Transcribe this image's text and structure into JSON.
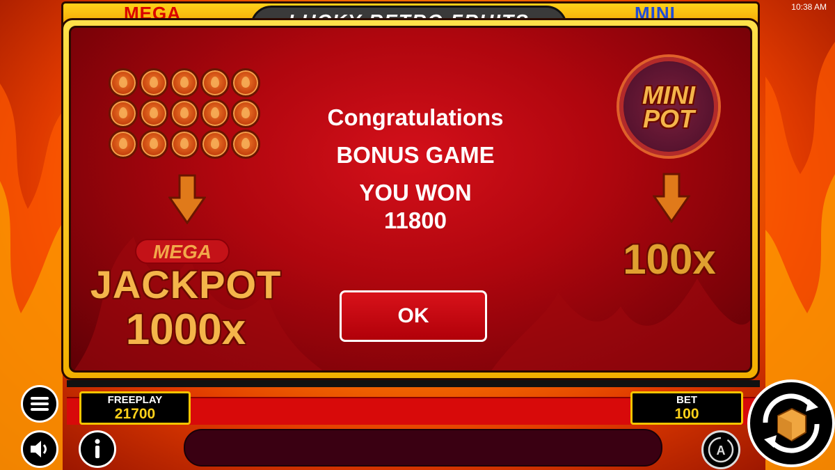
{
  "clock": "10:38 AM",
  "top_frame": {
    "mega_label": "MEGA",
    "mini_label": "MINI",
    "title": "LUCKY RETRO FRUITS"
  },
  "dialog": {
    "left_panel": {
      "mega_label": "MEGA",
      "jackpot_label": "JACKPOT",
      "multiplier": "1000x"
    },
    "right_panel": {
      "badge_label": "MINI POT",
      "multiplier": "100x"
    },
    "message": {
      "line1": "Congratulations",
      "line2": "BONUS GAME",
      "line3": "YOU WON",
      "amount": "11800"
    },
    "ok_label": "OK"
  },
  "hud": {
    "freeplay": {
      "label": "FREEPLAY",
      "value": "21700"
    },
    "bet": {
      "label": "BET",
      "value": "100"
    }
  },
  "icons": [
    "menu-icon",
    "sound-icon",
    "info-icon",
    "autoplay-icon",
    "spin-icon",
    "flame-icon",
    "down-arrow-icon"
  ],
  "colors": {
    "accent_gold": "#f5c400",
    "dialog_red": "#b0060e",
    "button_red": "#d8121a",
    "text_gold": "#f4b54a"
  }
}
